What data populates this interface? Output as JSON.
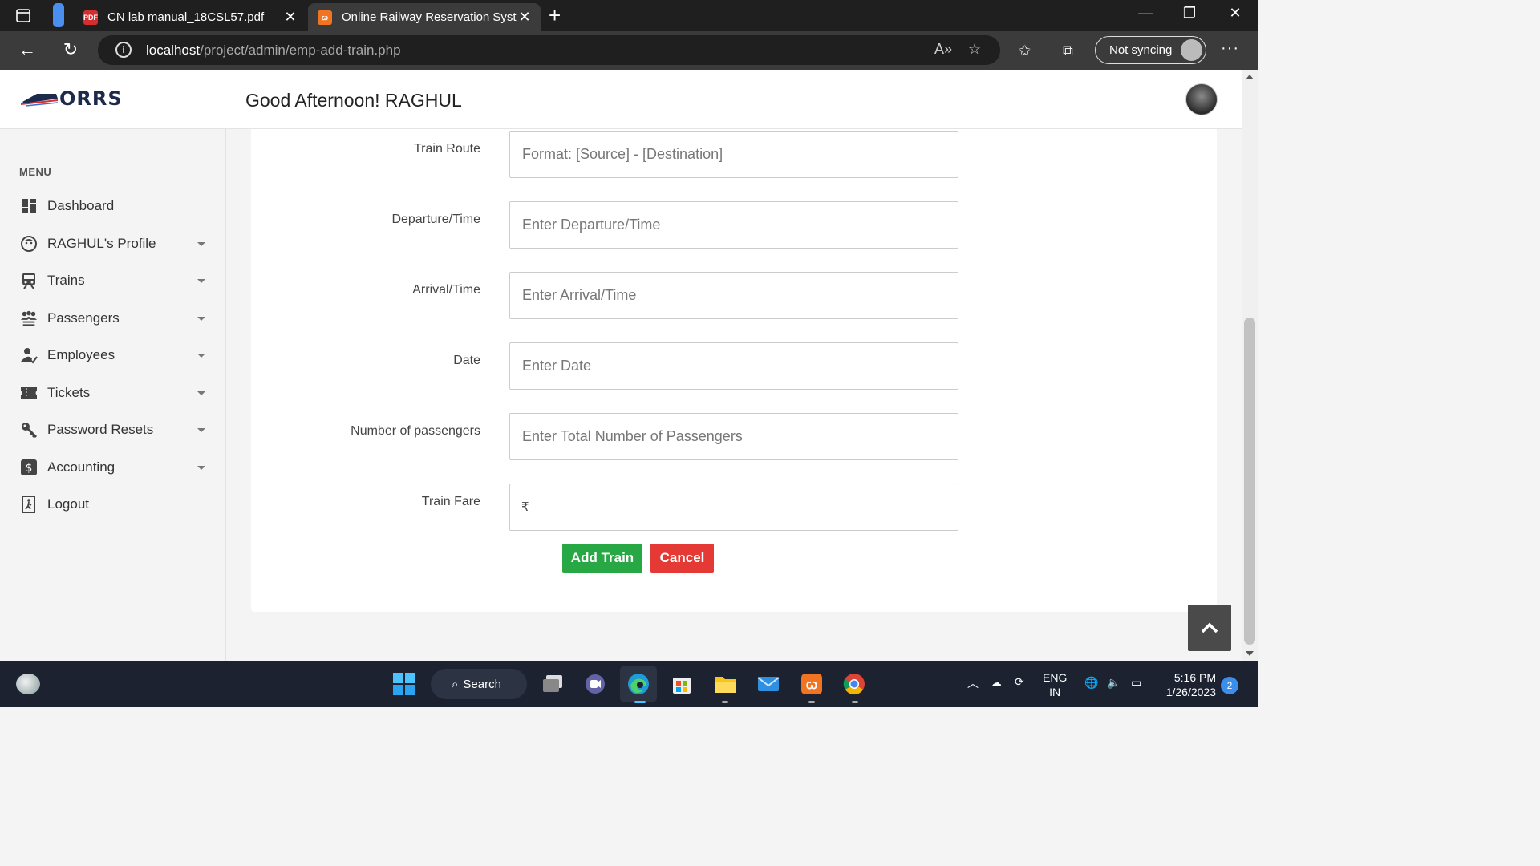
{
  "browser": {
    "tabs": [
      {
        "label": "CN lab manual_18CSL57.pdf",
        "icon": "pdf-icon"
      },
      {
        "label": "Online Railway Reservation Syste",
        "icon": "xampp-icon"
      }
    ],
    "url_host": "localhost",
    "url_path": "/project/admin/emp-add-train.php",
    "sync_label": "Not syncing"
  },
  "app": {
    "logo_text": "ORRS",
    "greeting": "Good Afternoon! RAGHUL"
  },
  "sidebar": {
    "menu_heading": "MENU",
    "items": [
      {
        "label": "Dashboard",
        "icon": "dashboard-icon",
        "has_submenu": false
      },
      {
        "label": "RAGHUL's Profile",
        "icon": "profile-icon",
        "has_submenu": true
      },
      {
        "label": "Trains",
        "icon": "train-icon",
        "has_submenu": true
      },
      {
        "label": "Passengers",
        "icon": "passengers-icon",
        "has_submenu": true
      },
      {
        "label": "Employees",
        "icon": "employees-icon",
        "has_submenu": true
      },
      {
        "label": "Tickets",
        "icon": "ticket-icon",
        "has_submenu": true
      },
      {
        "label": "Password Resets",
        "icon": "key-icon",
        "has_submenu": true
      },
      {
        "label": "Accounting",
        "icon": "dollar-icon",
        "has_submenu": true
      },
      {
        "label": "Logout",
        "icon": "logout-icon",
        "has_submenu": false
      }
    ]
  },
  "form": {
    "fields": [
      {
        "label": "Train Route",
        "placeholder": "Format: [Source] - [Destination]",
        "value": ""
      },
      {
        "label": "Departure/Time",
        "placeholder": "Enter Departure/Time",
        "value": ""
      },
      {
        "label": "Arrival/Time",
        "placeholder": "Enter Arrival/Time",
        "value": ""
      },
      {
        "label": "Date",
        "placeholder": "Enter Date",
        "value": ""
      },
      {
        "label": "Number of passengers",
        "placeholder": "Enter Total Number of Passengers",
        "value": ""
      },
      {
        "label": "Train Fare",
        "placeholder": "",
        "value": "",
        "prefix": "₹"
      }
    ],
    "submit_label": "Add Train",
    "cancel_label": "Cancel"
  },
  "taskbar": {
    "search_label": "Search",
    "lang_line1": "ENG",
    "lang_line2": "IN",
    "time": "5:16 PM",
    "date": "1/26/2023",
    "notification_count": "2"
  },
  "colors": {
    "add_button": "#28a745",
    "cancel_button": "#e53935",
    "logo": "#1c2a4d"
  }
}
